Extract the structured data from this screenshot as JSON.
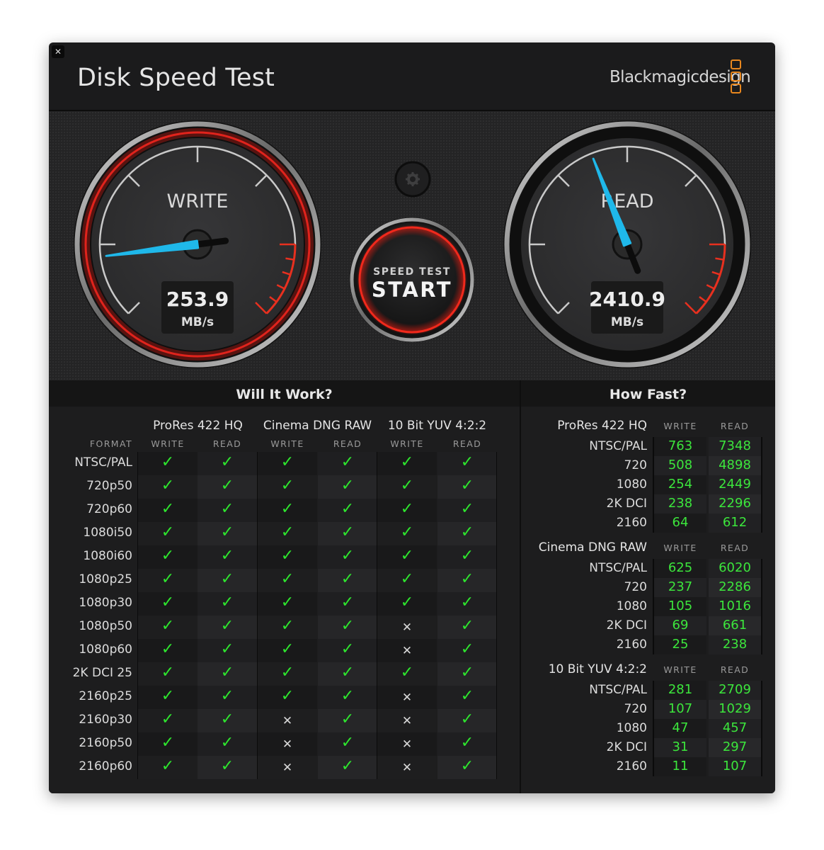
{
  "window": {
    "title": "Disk Speed Test",
    "close_icon": "close-icon",
    "brand": "Blackmagicdesign",
    "brand_color": "#e8871e"
  },
  "gauges": {
    "write": {
      "label": "WRITE",
      "value": "253.9",
      "unit": "MB/s",
      "needle_fraction": 0.14,
      "ring_color": "#e0231c"
    },
    "read": {
      "label": "READ",
      "value": "2410.9",
      "unit": "MB/s",
      "needle_fraction": 0.42,
      "ring_color": "#9a9a9a"
    },
    "needle_color": "#1fb8ea",
    "redline_color": "#e8301f"
  },
  "controls": {
    "settings_icon": "gear-icon",
    "start_line1": "SPEED TEST",
    "start_line2": "START"
  },
  "will_it_work": {
    "title": "Will It Work?",
    "format_header": "FORMAT",
    "groups": [
      "ProRes 422 HQ",
      "Cinema DNG RAW",
      "10 Bit YUV 4:2:2"
    ],
    "sub_headers": [
      "WRITE",
      "READ",
      "WRITE",
      "READ",
      "WRITE",
      "READ"
    ],
    "rows": [
      {
        "format": "NTSC/PAL",
        "cells": [
          true,
          true,
          true,
          true,
          true,
          true
        ]
      },
      {
        "format": "720p50",
        "cells": [
          true,
          true,
          true,
          true,
          true,
          true
        ]
      },
      {
        "format": "720p60",
        "cells": [
          true,
          true,
          true,
          true,
          true,
          true
        ]
      },
      {
        "format": "1080i50",
        "cells": [
          true,
          true,
          true,
          true,
          true,
          true
        ]
      },
      {
        "format": "1080i60",
        "cells": [
          true,
          true,
          true,
          true,
          true,
          true
        ]
      },
      {
        "format": "1080p25",
        "cells": [
          true,
          true,
          true,
          true,
          true,
          true
        ]
      },
      {
        "format": "1080p30",
        "cells": [
          true,
          true,
          true,
          true,
          true,
          true
        ]
      },
      {
        "format": "1080p50",
        "cells": [
          true,
          true,
          true,
          true,
          false,
          true
        ]
      },
      {
        "format": "1080p60",
        "cells": [
          true,
          true,
          true,
          true,
          false,
          true
        ]
      },
      {
        "format": "2K DCI 25",
        "cells": [
          true,
          true,
          true,
          true,
          true,
          true
        ]
      },
      {
        "format": "2160p25",
        "cells": [
          true,
          true,
          true,
          true,
          false,
          true
        ]
      },
      {
        "format": "2160p30",
        "cells": [
          true,
          true,
          false,
          true,
          false,
          true
        ]
      },
      {
        "format": "2160p50",
        "cells": [
          true,
          true,
          false,
          true,
          false,
          true
        ]
      },
      {
        "format": "2160p60",
        "cells": [
          true,
          true,
          false,
          true,
          false,
          true
        ]
      }
    ],
    "check_glyph": "✓",
    "cross_glyph": "✕",
    "check_color": "#2ee62e"
  },
  "how_fast": {
    "title": "How Fast?",
    "write_header": "WRITE",
    "read_header": "READ",
    "groups": [
      {
        "name": "ProRes 422 HQ",
        "rows": [
          {
            "label": "NTSC/PAL",
            "write": "763",
            "read": "7348"
          },
          {
            "label": "720",
            "write": "508",
            "read": "4898"
          },
          {
            "label": "1080",
            "write": "254",
            "read": "2449"
          },
          {
            "label": "2K DCI",
            "write": "238",
            "read": "2296"
          },
          {
            "label": "2160",
            "write": "64",
            "read": "612"
          }
        ]
      },
      {
        "name": "Cinema DNG RAW",
        "rows": [
          {
            "label": "NTSC/PAL",
            "write": "625",
            "read": "6020"
          },
          {
            "label": "720",
            "write": "237",
            "read": "2286"
          },
          {
            "label": "1080",
            "write": "105",
            "read": "1016"
          },
          {
            "label": "2K DCI",
            "write": "69",
            "read": "661"
          },
          {
            "label": "2160",
            "write": "25",
            "read": "238"
          }
        ]
      },
      {
        "name": "10 Bit YUV 4:2:2",
        "rows": [
          {
            "label": "NTSC/PAL",
            "write": "281",
            "read": "2709"
          },
          {
            "label": "720",
            "write": "107",
            "read": "1029"
          },
          {
            "label": "1080",
            "write": "47",
            "read": "457"
          },
          {
            "label": "2K DCI",
            "write": "31",
            "read": "297"
          },
          {
            "label": "2160",
            "write": "11",
            "read": "107"
          }
        ]
      }
    ],
    "value_color": "#3ce63c"
  }
}
